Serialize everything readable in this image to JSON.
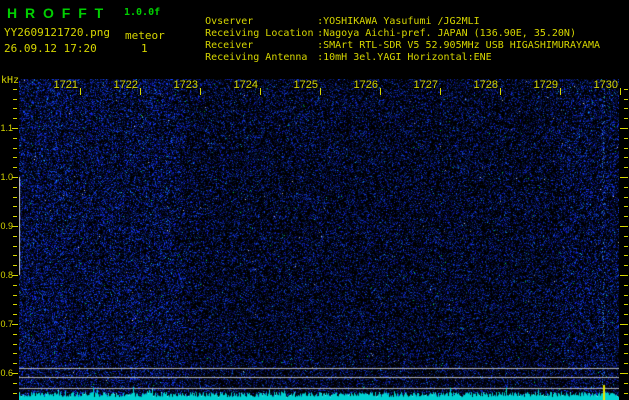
{
  "header": {
    "app_title": "H R O F F T",
    "version": "1.0.0f",
    "filename": "YY2609121720.png",
    "mode": "meteor",
    "datetime": "26.09.12 17:20",
    "sequence": "1",
    "info": [
      {
        "label": "Ovserver",
        "value": ":YOSHIKAWA Yasufumi /JG2MLI"
      },
      {
        "label": "Receiving Location",
        "value": ":Nagoya Aichi-pref. JAPAN (136.90E, 35.20N)"
      },
      {
        "label": "Receiver",
        "value": ":SMArt RTL-SDR V5 52.905MHz USB HIGASHIMURAYAMA"
      },
      {
        "label": "Receiving Antenna",
        "value": ":10mH 3el.YAGI Horizontal:ENE"
      }
    ]
  },
  "spectrogram": {
    "freq_axis": {
      "unit": "kHz",
      "major_labels": [
        "1.1",
        "1.0",
        "0.9",
        "0.8",
        "0.7",
        "0.6"
      ],
      "minor_step_khz": 0.02,
      "range_top_khz": 1.18,
      "range_bottom_khz": 0.56
    },
    "time_axis": {
      "labels": [
        "1721",
        "1722",
        "1723",
        "1724",
        "1725",
        "1726",
        "1727",
        "1728",
        "1729",
        "1730"
      ]
    },
    "colors": {
      "title_green": "#00d000",
      "axis_yellow": "#d6d600",
      "noise_blue": "#2020c8",
      "trace_cyan": "#00dcdc",
      "ref_line_gray": "#b8b8b8",
      "event_marker_yellow": "#e6e600"
    }
  }
}
